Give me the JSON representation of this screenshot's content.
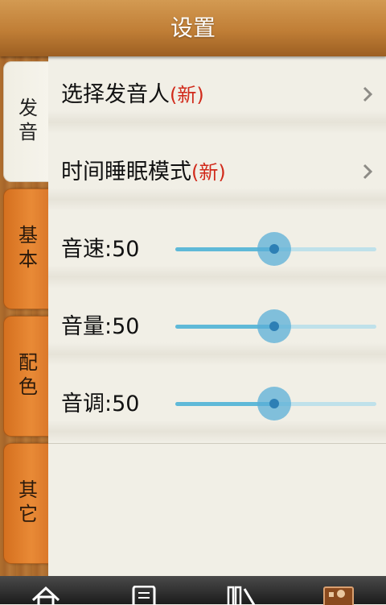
{
  "header": {
    "title": "设置"
  },
  "sidebar": {
    "tabs": [
      {
        "label": "发音",
        "active": true
      },
      {
        "label": "基本",
        "active": false
      },
      {
        "label": "配色",
        "active": false
      },
      {
        "label": "其它",
        "active": false
      }
    ]
  },
  "rows": [
    {
      "label": "选择发音人",
      "badge": "(新)"
    },
    {
      "label": "时间睡眠模式",
      "badge": "(新)"
    }
  ],
  "sliders": [
    {
      "label": "音速:50",
      "value": 50,
      "max": 100
    },
    {
      "label": "音量:50",
      "value": 50,
      "max": 100
    },
    {
      "label": "音调:50",
      "value": 50,
      "max": 100
    }
  ],
  "bottom_nav": [
    "home-icon",
    "document-icon",
    "bookshelf-icon",
    "contact-icon"
  ],
  "colors": {
    "accent": "#5fb9d8",
    "badge": "#d12a1b",
    "tab": "#e98a36"
  }
}
